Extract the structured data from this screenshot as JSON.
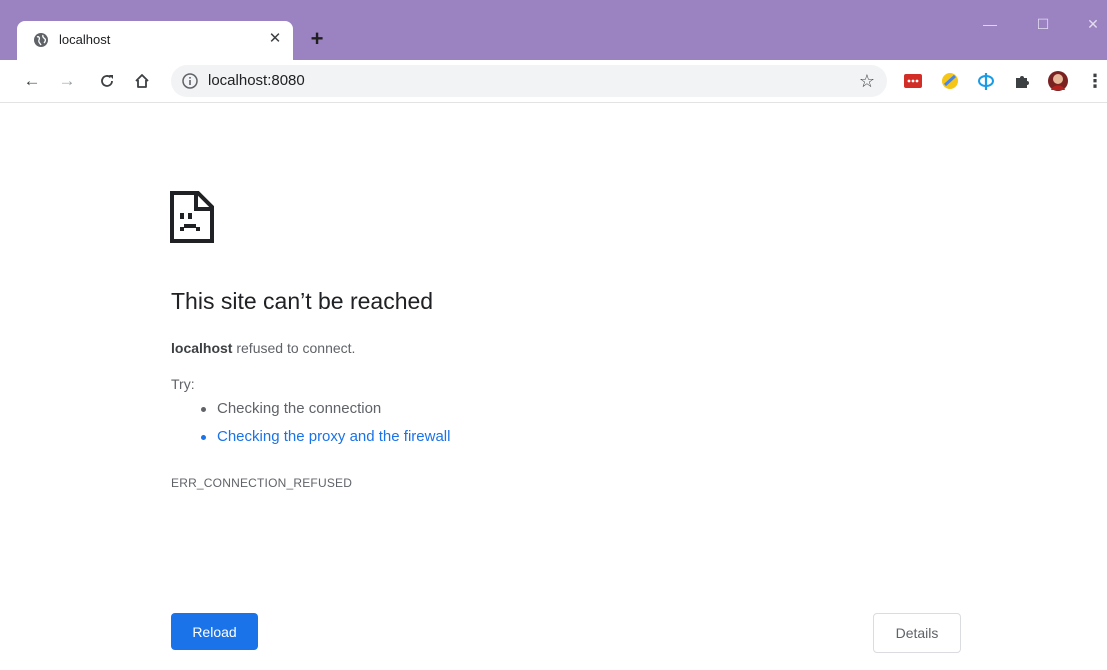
{
  "tab": {
    "title": "localhost",
    "close_glyph": "✕",
    "icon": "globe-icon"
  },
  "tabstrip": {
    "new_tab_glyph": "+",
    "minimize_glyph": "—",
    "maximize_glyph": "☐",
    "close_glyph": "✕",
    "background_color": "#9b82c1"
  },
  "toolbar": {
    "back_glyph": "←",
    "forward_glyph": "→",
    "reload_glyph": "C",
    "home_glyph": "⌂",
    "star_glyph": "☆",
    "menu_glyph": "⋮",
    "extensions": [
      "lastpass-icon",
      "yellow-extension-icon",
      "phi-extension-icon",
      "puzzle-icon",
      "profile-avatar"
    ]
  },
  "omnibox": {
    "url": "localhost:8080",
    "icon": "info-icon"
  },
  "error": {
    "heading": "This site can’t be reached",
    "host": "localhost",
    "message": " refused to connect.",
    "try_label": "Try:",
    "suggestions": [
      "Checking the connection",
      "Checking the proxy and the firewall"
    ],
    "code": "ERR_CONNECTION_REFUSED"
  },
  "buttons": {
    "reload": "Reload",
    "details": "Details"
  },
  "colors": {
    "accent": "#1a73e8",
    "text": "#202124",
    "secondary_text": "#5f6368"
  }
}
